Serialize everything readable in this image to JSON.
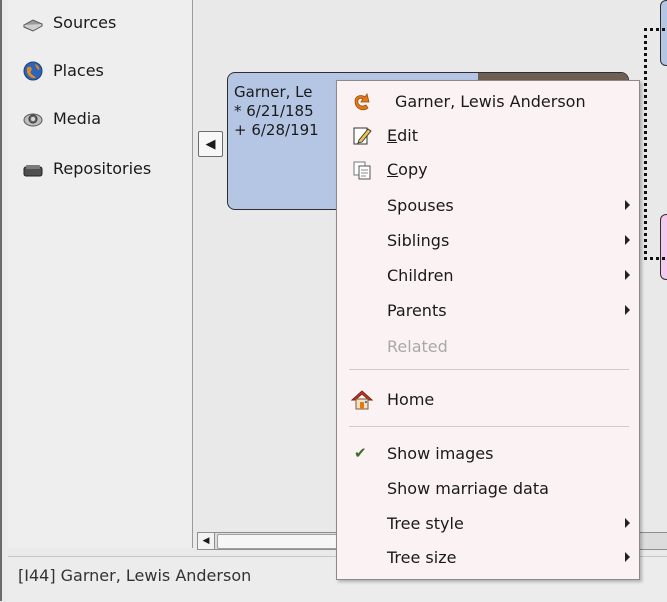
{
  "sidebar": {
    "items": [
      {
        "label": "Sources",
        "icon": "sources-book-icon"
      },
      {
        "label": "Places",
        "icon": "globe-icon"
      },
      {
        "label": "Media",
        "icon": "media-camera-icon"
      },
      {
        "label": "Repositories",
        "icon": "repository-box-icon"
      }
    ]
  },
  "person": {
    "name": "Garner, Le",
    "birth": "* 6/21/185",
    "death": "+ 6/28/191"
  },
  "nav": {
    "left_arrow": "◀",
    "scroll_left": "◀"
  },
  "menu": {
    "header": "Garner, Lewis Anderson",
    "edit": {
      "first": "E",
      "rest": "dit"
    },
    "copy": {
      "first": "C",
      "rest": "opy"
    },
    "spouses": "Spouses",
    "siblings": "Siblings",
    "children": "Children",
    "parents": "Parents",
    "related": "Related",
    "home": "Home",
    "show_images": "Show images",
    "show_images_check": "✔",
    "show_marriage": "Show marriage data",
    "tree_style": "Tree style",
    "tree_size": "Tree size"
  },
  "status": {
    "text": "[I44]  Garner, Lewis Anderson"
  },
  "colors": {
    "male_box": "#b4c6e4",
    "female_box": "#f5c8ee",
    "menu_bg": "#fbf3f3",
    "accent_orange": "#e07b1a"
  }
}
